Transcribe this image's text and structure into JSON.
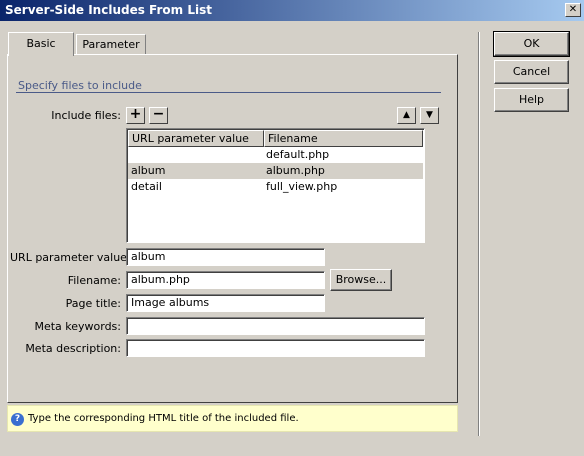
{
  "window": {
    "title": "Server-Side Includes From List",
    "close_glyph": "✕"
  },
  "tabs": [
    {
      "label": "Basic",
      "active": true
    },
    {
      "label": "Parameter",
      "active": false
    }
  ],
  "section_title": "Specify files to include",
  "include_files": {
    "label": "Include files:",
    "add_glyph": "+",
    "remove_glyph": "−",
    "up_glyph": "▲",
    "down_glyph": "▼"
  },
  "list": {
    "columns": [
      "URL parameter value",
      "Filename"
    ],
    "rows": [
      {
        "param": "",
        "file": "default.php",
        "selected": false
      },
      {
        "param": "album",
        "file": "album.php",
        "selected": true
      },
      {
        "param": "detail",
        "file": "full_view.php",
        "selected": false
      }
    ]
  },
  "form": {
    "url_param_label": "URL parameter value:",
    "url_param_value": "album",
    "filename_label": "Filename:",
    "filename_value": "album.php",
    "browse_label": "Browse...",
    "page_title_label": "Page title:",
    "page_title_value": "Image albums",
    "meta_keywords_label": "Meta keywords:",
    "meta_keywords_value": "",
    "meta_description_label": "Meta description:",
    "meta_description_value": ""
  },
  "buttons": {
    "ok": "OK",
    "cancel": "Cancel",
    "help": "Help"
  },
  "hint": {
    "icon": "?",
    "text": "Type the corresponding HTML title of the included file."
  },
  "colors": {
    "title_start": "#0a246a",
    "title_end": "#a6caf0",
    "hint_bg": "#ffffcc",
    "section_color": "#4a5a88"
  }
}
